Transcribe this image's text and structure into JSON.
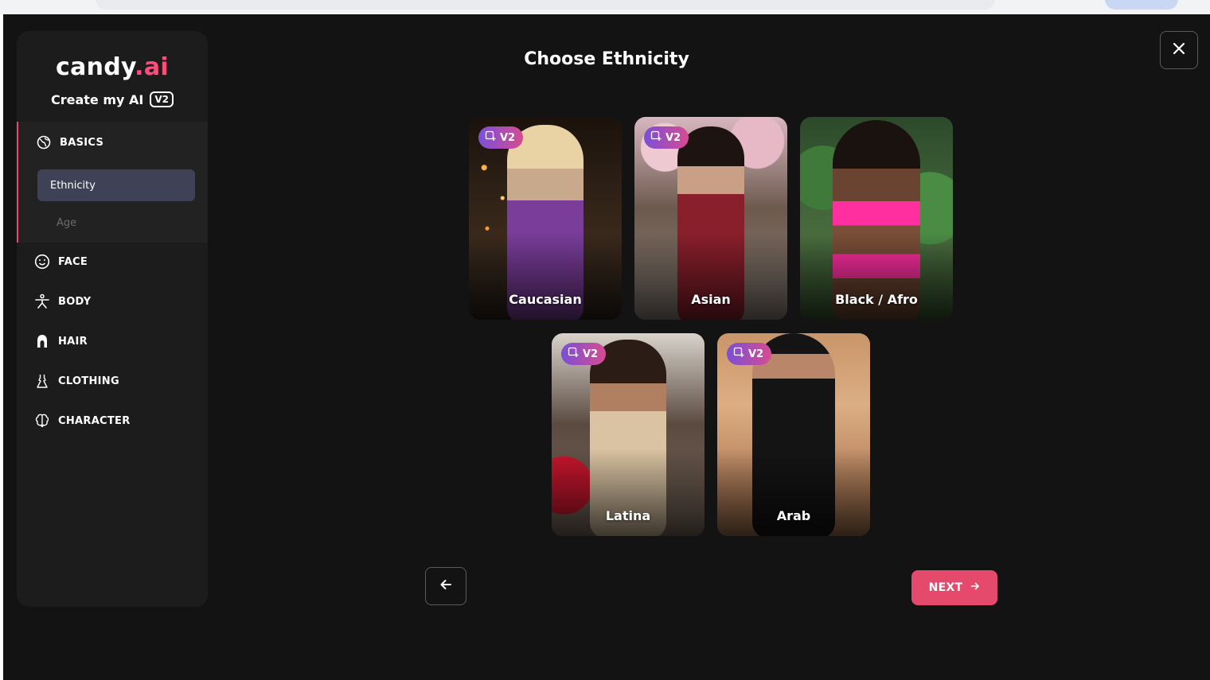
{
  "app": {
    "logo_main": "candy",
    "logo_accent": ".ai",
    "subtitle": "Create my AI",
    "version_badge": "V2"
  },
  "sidebar": {
    "sections": [
      {
        "label": "BASICS",
        "icon": "globe-icon"
      },
      {
        "label": "FACE",
        "icon": "smiley-icon"
      },
      {
        "label": "BODY",
        "icon": "person-icon"
      },
      {
        "label": "HAIR",
        "icon": "hair-icon"
      },
      {
        "label": "CLOTHING",
        "icon": "dress-icon"
      },
      {
        "label": "CHARACTER",
        "icon": "brain-icon"
      }
    ],
    "basics_subitems": [
      {
        "label": "Ethnicity",
        "active": true
      },
      {
        "label": "Age",
        "active": false
      }
    ]
  },
  "main": {
    "title": "Choose Ethnicity",
    "cards": [
      {
        "label": "Caucasian",
        "badge": "V2"
      },
      {
        "label": "Asian",
        "badge": "V2"
      },
      {
        "label": "Black / Afro",
        "badge": ""
      },
      {
        "label": "Latina",
        "badge": "V2"
      },
      {
        "label": "Arab",
        "badge": "V2"
      }
    ],
    "next_label": "NEXT"
  },
  "colors": {
    "accent": "#e5496c",
    "background": "#131313",
    "sidebar": "#1c1c1c",
    "active_item": "#3f4256"
  }
}
